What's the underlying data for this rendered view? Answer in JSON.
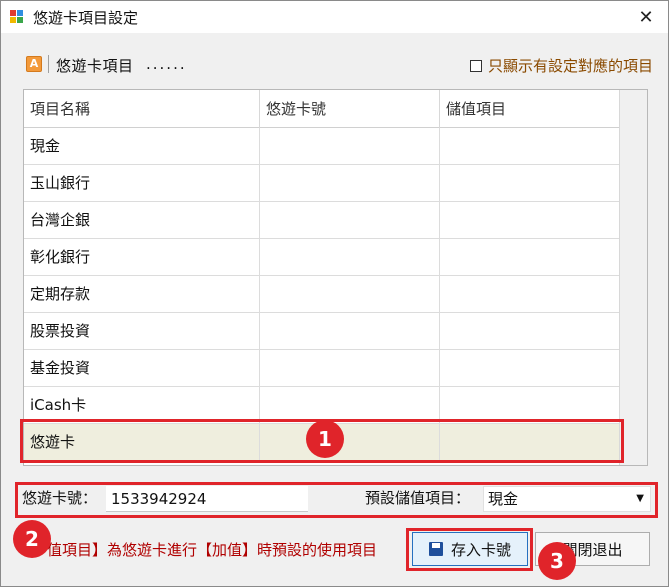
{
  "window": {
    "title": "悠遊卡項目設定",
    "close_glyph": "✕"
  },
  "header": {
    "icon_letter": "A",
    "title": "悠遊卡項目",
    "dots": "......",
    "checkbox_label": "只顯示有設定對應的項目",
    "checkbox_checked": false
  },
  "grid": {
    "columns": [
      "項目名稱",
      "悠遊卡號",
      "儲值項目"
    ],
    "rows": [
      {
        "name": "現金",
        "card": "",
        "stored": ""
      },
      {
        "name": "玉山銀行",
        "card": "",
        "stored": ""
      },
      {
        "name": "台灣企銀",
        "card": "",
        "stored": ""
      },
      {
        "name": "彰化銀行",
        "card": "",
        "stored": ""
      },
      {
        "name": "定期存款",
        "card": "",
        "stored": ""
      },
      {
        "name": "股票投資",
        "card": "",
        "stored": ""
      },
      {
        "name": "基金投資",
        "card": "",
        "stored": ""
      },
      {
        "name": "iCash卡",
        "card": "",
        "stored": ""
      },
      {
        "name": "悠遊卡",
        "card": "",
        "stored": ""
      }
    ],
    "selected_row": 8
  },
  "form": {
    "card_label": "悠遊卡號：",
    "card_value": "1533942924",
    "default_label": "預設儲值項目：",
    "default_value": "現金"
  },
  "footer": {
    "note": "值項目】為悠遊卡進行【加值】時預設的使用項目",
    "save_label": "存入卡號",
    "exit_label": "關閉退出"
  },
  "badges": [
    "1",
    "2",
    "3"
  ],
  "colors": {
    "highlight": "#e0242a",
    "note": "#b00000",
    "selected_row": "#efeede"
  }
}
